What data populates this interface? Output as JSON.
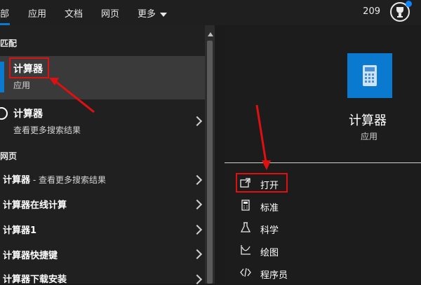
{
  "topbar": {
    "tabs": [
      "部",
      "应用",
      "文档",
      "网页",
      "更多"
    ],
    "points": "209"
  },
  "left": {
    "best_match_title": "匹配",
    "best_match": {
      "title": "计算器",
      "subtitle": "应用"
    },
    "search_item": {
      "title": "计算器",
      "subtitle": "查看更多搜索结果"
    },
    "web_title": "网页",
    "web_rows": [
      {
        "title": "计算器",
        "suffix": " - 查看更多搜索结果"
      },
      {
        "title": "计算器在线计算",
        "suffix": ""
      },
      {
        "title": "计算器1",
        "suffix": ""
      },
      {
        "title": "计算器快捷键",
        "suffix": ""
      },
      {
        "title": "计算器下载安装",
        "suffix": ""
      }
    ]
  },
  "right": {
    "app_name": "计算器",
    "app_type": "应用",
    "actions": [
      "打开",
      "标准",
      "科学",
      "绘图",
      "程序员"
    ]
  },
  "colors": {
    "accent": "#0a7ad1",
    "annotation": "#e01010"
  }
}
